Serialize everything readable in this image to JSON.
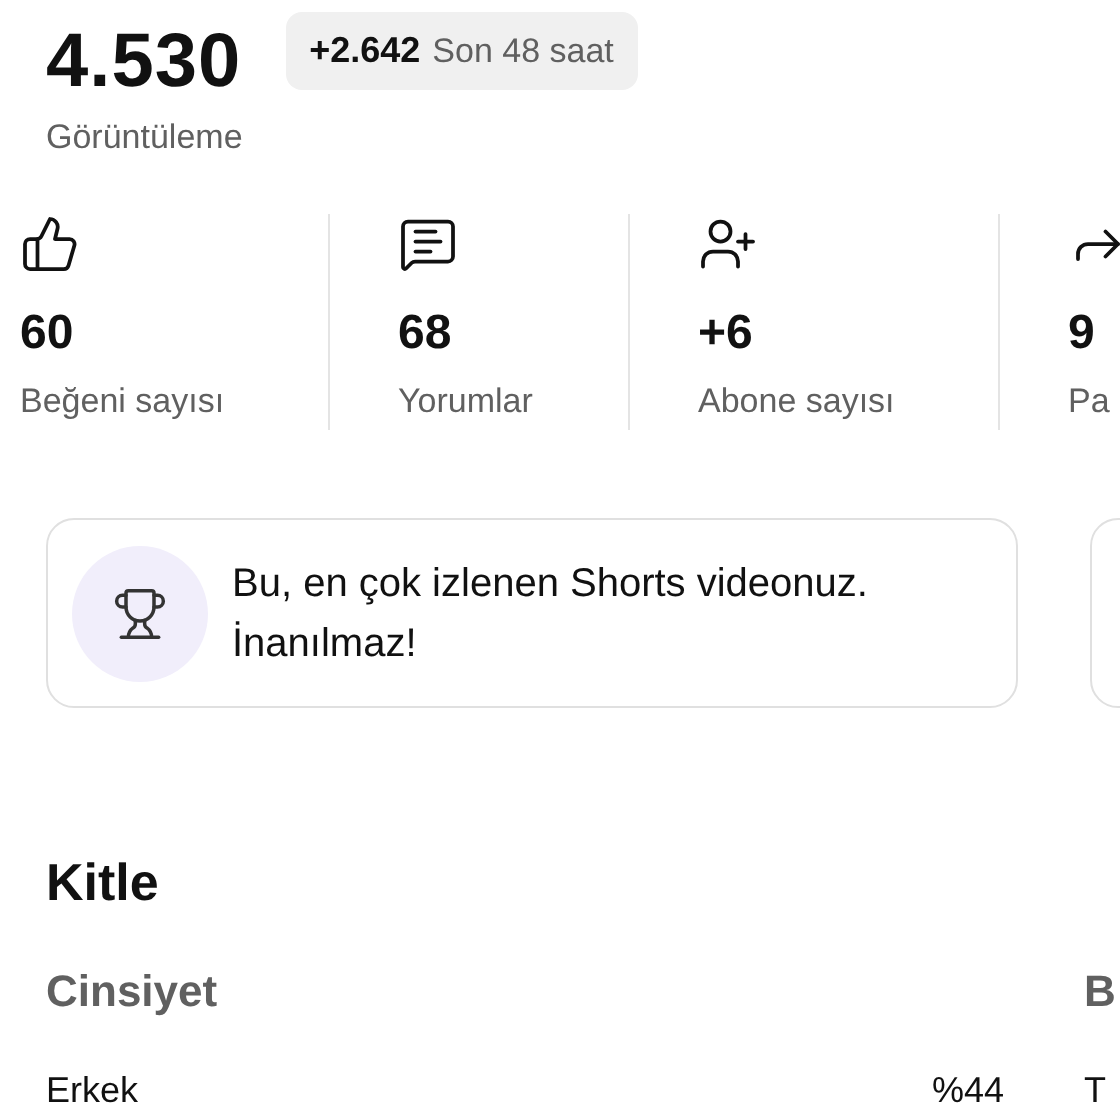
{
  "views": {
    "value": "4.530",
    "label": "Görüntüleme",
    "delta": "+2.642",
    "period": "Son 48 saat"
  },
  "stats": [
    {
      "kind": "likes",
      "value": "60",
      "label": "Beğeni sayısı"
    },
    {
      "kind": "comments",
      "value": "68",
      "label": "Yorumlar"
    },
    {
      "kind": "subscribers",
      "value": "+6",
      "label": "Abone sayısı"
    },
    {
      "kind": "shares",
      "value": "9",
      "label": "Pa"
    }
  ],
  "insight_card": {
    "text": "Bu, en çok izlenen Shorts videonuz. İnanılmaz!"
  },
  "audience": {
    "title": "Kitle",
    "gender": {
      "title": "Cinsiyet",
      "rows": [
        {
          "label": "Erkek",
          "value": "%44"
        }
      ]
    },
    "column_2": {
      "title": "B",
      "rows": [
        {
          "label": "T"
        }
      ]
    }
  }
}
